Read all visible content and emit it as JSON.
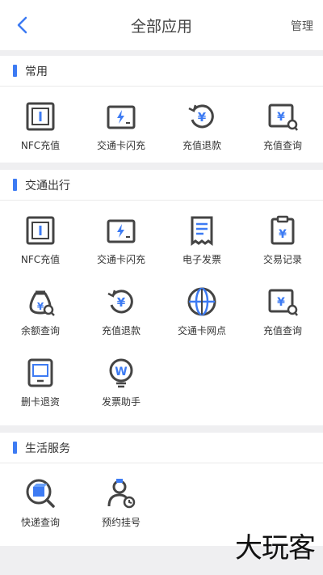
{
  "header": {
    "title": "全部应用",
    "manage_label": "管理"
  },
  "colors": {
    "accent": "#3d7bf3",
    "icon_dark": "#444444"
  },
  "sections": [
    {
      "title": "常用",
      "items": [
        {
          "label": "NFC充值",
          "icon": "nfc-card-icon"
        },
        {
          "label": "交通卡闪充",
          "icon": "flash-charge-icon"
        },
        {
          "label": "充值退款",
          "icon": "refund-icon"
        },
        {
          "label": "充值查询",
          "icon": "recharge-query-icon"
        }
      ]
    },
    {
      "title": "交通出行",
      "items": [
        {
          "label": "NFC充值",
          "icon": "nfc-card-icon"
        },
        {
          "label": "交通卡闪充",
          "icon": "flash-charge-icon"
        },
        {
          "label": "电子发票",
          "icon": "receipt-icon"
        },
        {
          "label": "交易记录",
          "icon": "transaction-record-icon"
        },
        {
          "label": "余额查询",
          "icon": "money-bag-search-icon"
        },
        {
          "label": "充值退款",
          "icon": "refund-icon"
        },
        {
          "label": "交通卡网点",
          "icon": "globe-icon"
        },
        {
          "label": "充值查询",
          "icon": "recharge-query-icon"
        },
        {
          "label": "删卡退资",
          "icon": "delete-card-icon"
        },
        {
          "label": "发票助手",
          "icon": "invoice-assistant-icon"
        }
      ]
    },
    {
      "title": "生活服务",
      "items": [
        {
          "label": "快递查询",
          "icon": "package-search-icon"
        },
        {
          "label": "预约挂号",
          "icon": "doctor-appointment-icon"
        }
      ]
    }
  ],
  "watermark": "大玩客"
}
